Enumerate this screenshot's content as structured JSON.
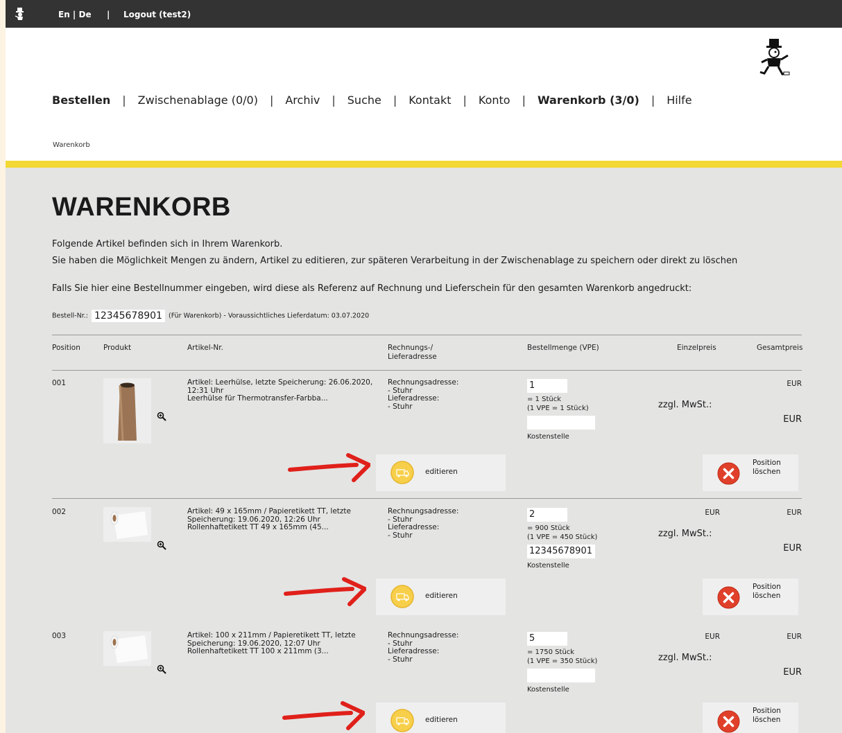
{
  "topbar": {
    "lang": "En | De",
    "sep": "|",
    "logout": "Logout (test2)"
  },
  "nav": {
    "items": [
      "Bestellen",
      "Zwischenablage (0/0)",
      "Archiv",
      "Suche",
      "Kontakt",
      "Konto",
      "Warenkorb (3/0)",
      "Hilfe"
    ],
    "separator": "|"
  },
  "breadcrumb": "Warenkorb",
  "page": {
    "title": "WARENKORB",
    "intro1": "Folgende Artikel befinden sich in Ihrem Warenkorb.",
    "intro2": "Sie haben die Möglichkeit Mengen zu ändern, Artikel zu editieren, zur späteren Verarbeitung in der Zwischenablage zu speichern oder direkt zu löschen",
    "intro3": "Falls Sie hier eine Bestellnummer eingeben, wird diese als Referenz auf Rechnung und Lieferschein für den gesamten Warenkorb angedruckt:",
    "order_label": "Bestell-Nr.:",
    "order_value": "12345678901",
    "order_note": "(Für Warenkorb) - Voraussichtliches Lieferdatum: 03.07.2020"
  },
  "table": {
    "headers": {
      "position": "Position",
      "produkt": "Produkt",
      "artikel": "Artikel-Nr.",
      "adresse_1": "Rechnungs-/",
      "adresse_2": "Lieferadresse",
      "menge": "Bestellmenge (VPE)",
      "einzel": "Einzelpreis",
      "gesamt": "Gesamtpreis"
    },
    "rows": [
      {
        "pos": "001",
        "art1": "Artikel: Leerhülse, letzte Speicherung: 26.06.2020,",
        "art2": "12:31 Uhr",
        "art3": "Leerhülse für Thermotransfer-Farbba...",
        "addr1": "Rechnungsadresse:",
        "addr2": "- Stuhr",
        "addr3": "Lieferadresse:",
        "addr4": "- Stuhr",
        "qty": "1",
        "qty_pieces": "= 1 Stück",
        "qty_vpe": "(1 VPE = 1 Stück)",
        "kostenstelle": "",
        "kst_label": "Kostenstelle",
        "einzel": "",
        "gesamt": "EUR",
        "mwst": "zzgl. MwSt.:",
        "mwst_eur": "EUR",
        "edit_label": "editieren",
        "del_label1": "Position",
        "del_label2": "löschen"
      },
      {
        "pos": "002",
        "art1": "Artikel: 49 x 165mm / Papieretikett TT, letzte",
        "art2": "Speicherung: 19.06.2020, 12:26 Uhr",
        "art3": "Rollenhaftetikett TT 49 x 165mm (45...",
        "addr1": "Rechnungsadresse:",
        "addr2": "- Stuhr",
        "addr3": "Lieferadresse:",
        "addr4": "- Stuhr",
        "qty": "2",
        "qty_pieces": "= 900 Stück",
        "qty_vpe": "(1 VPE = 450 Stück)",
        "kostenstelle": "12345678901",
        "kst_label": "Kostenstelle",
        "einzel": "EUR",
        "gesamt": "EUR",
        "mwst": "zzgl. MwSt.:",
        "mwst_eur": "EUR",
        "edit_label": "editieren",
        "del_label1": "Position",
        "del_label2": "löschen"
      },
      {
        "pos": "003",
        "art1": "Artikel: 100 x 211mm / Papieretikett TT, letzte",
        "art2": "Speicherung: 19.06.2020, 12:07 Uhr",
        "art3": "Rollenhaftetikett TT 100 x 211mm (3...",
        "addr1": "Rechnungsadresse:",
        "addr2": "- Stuhr",
        "addr3": "Lieferadresse:",
        "addr4": "- Stuhr",
        "qty": "5",
        "qty_pieces": "= 1750 Stück",
        "qty_vpe": "(1 VPE = 350 Stück)",
        "kostenstelle": "",
        "kst_label": "Kostenstelle",
        "einzel": "EUR",
        "gesamt": "EUR",
        "mwst": "zzgl. MwSt.:",
        "mwst_eur": "EUR",
        "edit_label": "editieren",
        "del_label1": "Position",
        "del_label2": "löschen"
      }
    ]
  },
  "colors": {
    "topbar": "#333333",
    "accent": "#f3d835",
    "content_bg": "#e4e4e3",
    "arrow": "#e0201a",
    "delete": "#e0402a",
    "edit": "#f7cf4a"
  }
}
